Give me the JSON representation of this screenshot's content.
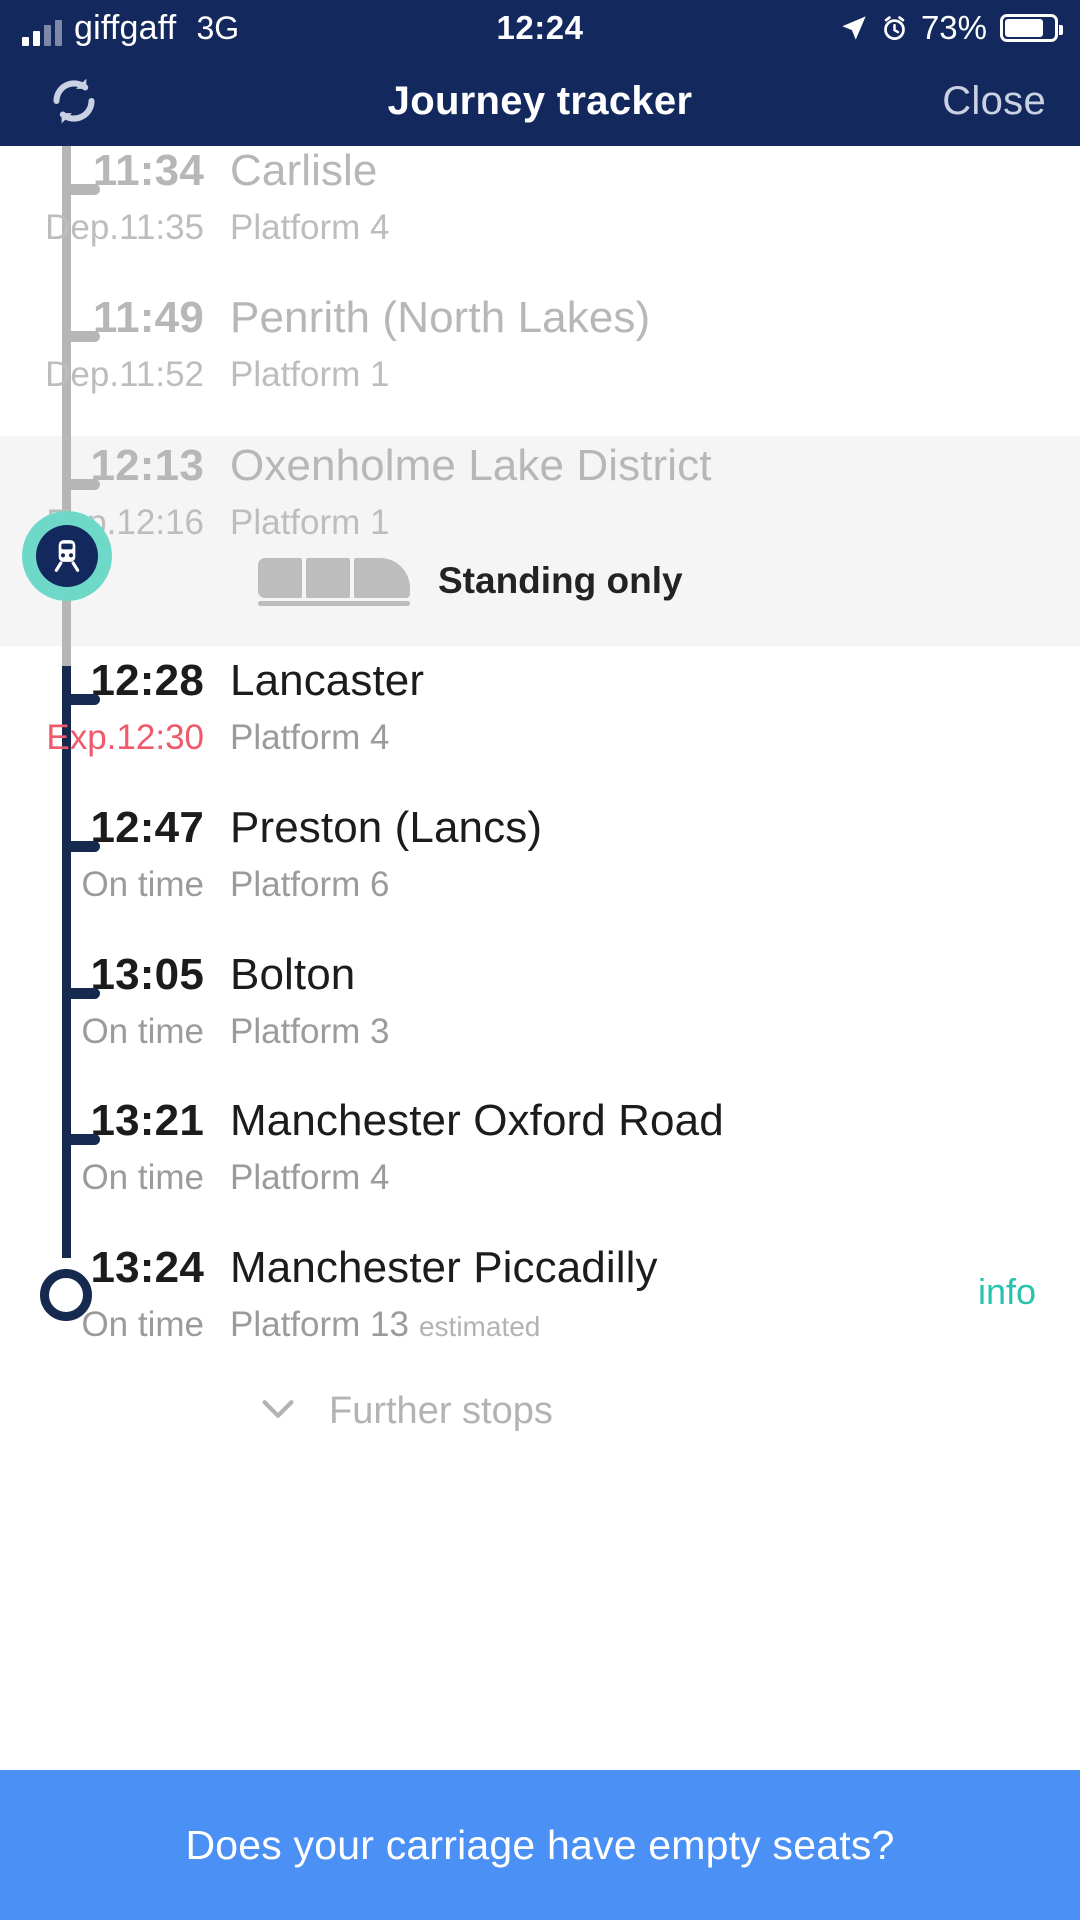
{
  "status_bar": {
    "carrier": "giffgaff",
    "network": "3G",
    "time": "12:24",
    "battery_percent": "73%",
    "signal_icon": "signal-bars-icon",
    "location_icon": "location-arrow-icon",
    "alarm_icon": "alarm-clock-icon",
    "battery_icon": "battery-icon"
  },
  "nav": {
    "refresh_icon": "refresh-icon",
    "title": "Journey tracker",
    "close_label": "Close"
  },
  "journey": {
    "stops": [
      {
        "time": "11:34",
        "name": "Carlisle",
        "status": "Dep.11:35",
        "platform": "Platform 4",
        "state": "past",
        "delayed": false
      },
      {
        "time": "11:49",
        "name": "Penrith (North Lakes)",
        "status": "Dep.11:52",
        "platform": "Platform 1",
        "state": "past",
        "delayed": false
      },
      {
        "time": "12:13",
        "name": "Oxenholme Lake District",
        "status": "Exp.12:16",
        "platform": "Platform 1",
        "state": "current",
        "delayed": false
      },
      {
        "time": "12:28",
        "name": "Lancaster",
        "status": "Exp.12:30",
        "platform": "Platform 4",
        "state": "future",
        "delayed": true
      },
      {
        "time": "12:47",
        "name": "Preston (Lancs)",
        "status": "On time",
        "platform": "Platform 6",
        "state": "future",
        "delayed": false
      },
      {
        "time": "13:05",
        "name": "Bolton",
        "status": "On time",
        "platform": "Platform 3",
        "state": "future",
        "delayed": false
      },
      {
        "time": "13:21",
        "name": "Manchester Oxford Road",
        "status": "On time",
        "platform": "Platform 4",
        "state": "future",
        "delayed": false
      },
      {
        "time": "13:24",
        "name": "Manchester Piccadilly",
        "status": "On time",
        "platform": "Platform 13",
        "platform_note": "estimated",
        "state": "terminus",
        "delayed": false,
        "info_label": "info"
      }
    ],
    "occupancy": {
      "icon": "train-carriage-icon",
      "label": "Standing only"
    },
    "train_marker_icon": "train-icon",
    "further_stops": {
      "chevron_icon": "chevron-down-icon",
      "label": "Further stops"
    }
  },
  "banner": {
    "text": "Does your carriage have empty seats?"
  },
  "colors": {
    "navy": "#13295e",
    "rail_future": "#16294f",
    "rail_past": "#b6b6b6",
    "teal": "#6fd9c9",
    "info_link": "#27c3ae",
    "delay_red": "#f0596a",
    "banner_blue": "#4a90f5",
    "highlight_band": "#f5f5f5"
  }
}
